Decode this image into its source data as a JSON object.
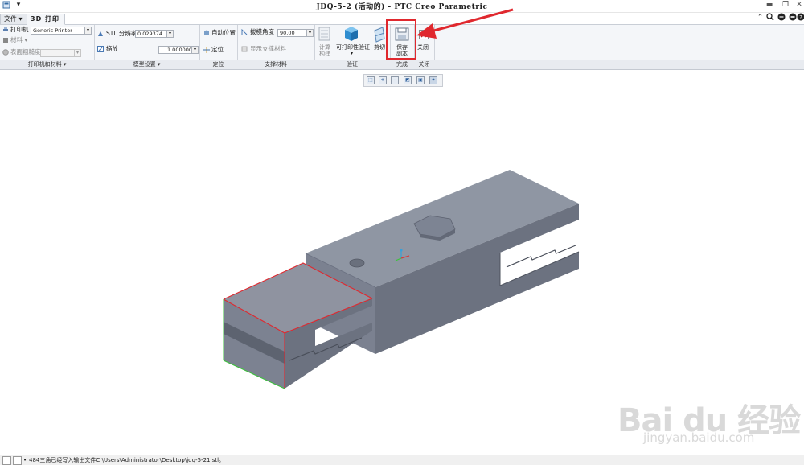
{
  "window": {
    "title": "JDQ-5-2 (活动的) - PTC Creo Parametric"
  },
  "tabs": {
    "file": "文件",
    "active": "3D 打印"
  },
  "ribbon": {
    "printer_label": "打印机",
    "printer_value": "Generic Printer",
    "material_label": "材料",
    "surface_label": "表面粗糙度",
    "stl_label": "STL 分辨率",
    "stl_value": "0.029374",
    "scale_label": "缩放",
    "scale_value": "1.000000",
    "auto_position": "自动位置",
    "position": "定位",
    "overhang_label": "拔模角度",
    "overhang_value": "90.00",
    "show_support": "显示支撑材料",
    "compute_label_1": "计算",
    "compute_label_2": "构建",
    "printability": "可打印性验证",
    "cut": "剪切",
    "save_copy_1": "保存",
    "save_copy_2": "副本",
    "close": "关闭"
  },
  "groups": {
    "printer_material": "打印机和材料",
    "model_settings": "模型设置",
    "position": "定位",
    "support": "支撑材料",
    "verify": "验证",
    "finish": "完成",
    "close": "关闭"
  },
  "status": {
    "message": "484三角已经写入输出文件C:\\Users\\Administrator\\Desktop\\jdq-5-21.stl。"
  },
  "watermark": {
    "brand": "Bai du 经验",
    "url": "jingyan.baidu.com"
  },
  "colors": {
    "model_top": "#8f96a3",
    "model_side": "#6e7482",
    "highlight_red": "#e0282e"
  }
}
